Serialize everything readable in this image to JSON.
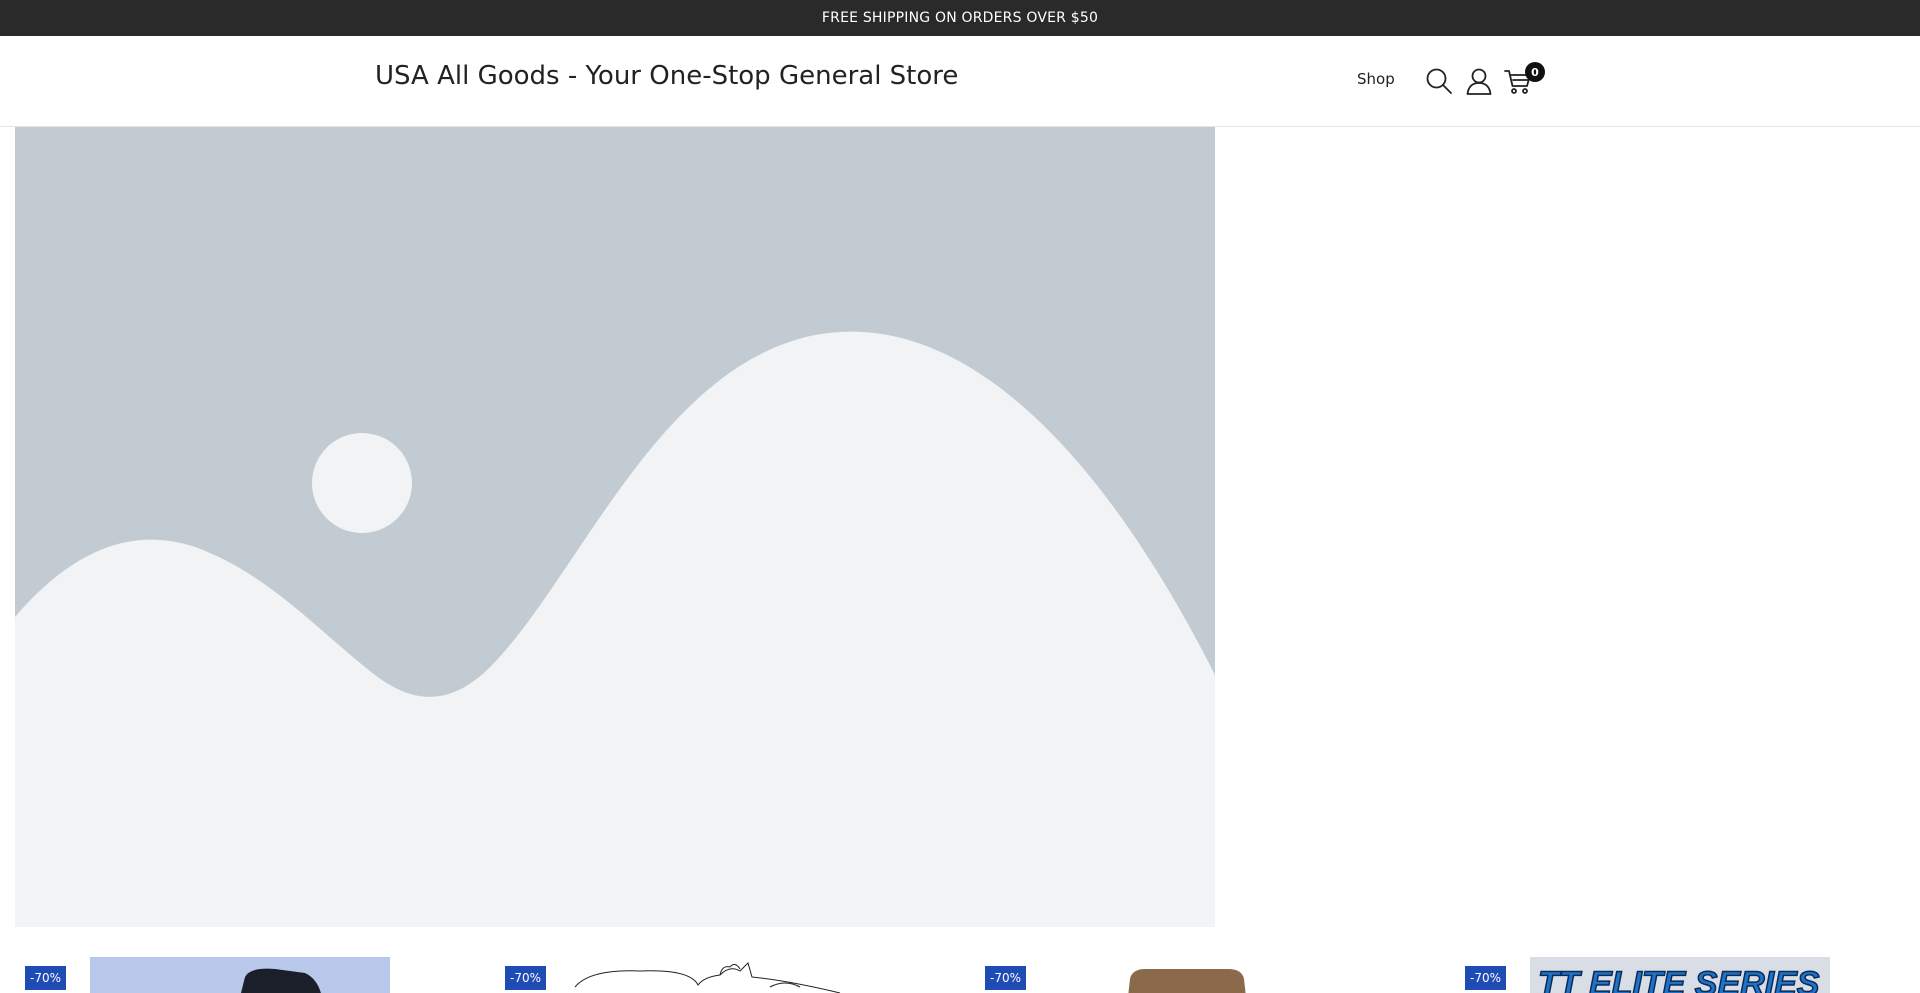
{
  "announcement": {
    "text": "FREE SHIPPING ON ORDERS OVER $50"
  },
  "header": {
    "site_title": "USA All Goods - Your One-Stop General Store",
    "nav": {
      "shop_label": "Shop"
    },
    "icons": {
      "search": "search-icon",
      "account": "account-icon",
      "cart": "cart-icon"
    },
    "cart_count": "0"
  },
  "hero": {
    "image": "placeholder-landscape-image"
  },
  "products": [
    {
      "badge": "-70%",
      "image": "black-product-photo"
    },
    {
      "badge": "-70%",
      "image": "line-drawing-product-photo"
    },
    {
      "badge": "-70%",
      "image": "brown-product-photo"
    },
    {
      "badge": "-70%",
      "image": "elite-series-product-photo",
      "image_text": "TT ELITE SERIES"
    }
  ],
  "colors": {
    "announcement_bg": "#2a2a2a",
    "badge_bg": "#1f4bb4",
    "placeholder_bg": "#c3cbd2",
    "placeholder_fg": "#f1f3f4"
  }
}
